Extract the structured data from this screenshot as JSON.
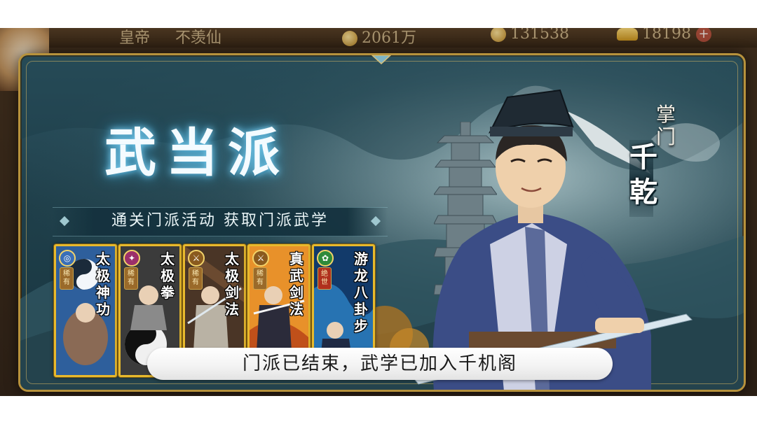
{
  "topbar": {
    "rank_text": "皇帝",
    "player_title": "不羡仙",
    "currency_1": "2061万",
    "currency_2": "131538",
    "currency_3": "18198"
  },
  "popup": {
    "title": "武当派",
    "subtitle": "通关门派活动  获取门派武学",
    "master": {
      "label": "掌门",
      "name": "千乾"
    },
    "cards": [
      {
        "name": "太极神功",
        "rarity": "稀有",
        "color": "#3a6fb8"
      },
      {
        "name": "太极拳",
        "rarity": "稀有",
        "color": "#333333"
      },
      {
        "name": "太极剑法",
        "rarity": "稀有",
        "color": "#5a4030"
      },
      {
        "name": "真武剑法",
        "rarity": "稀有",
        "color": "#e08a1e"
      },
      {
        "name": "游龙八卦步",
        "rarity": "绝世",
        "color": "#1c5f9c"
      }
    ],
    "status_text": "门派已结束，武学已加入千机阁"
  },
  "colors": {
    "frame_gold": "#b7923c",
    "card_border": "#e7b92d",
    "panel_teal": "#1f3f4a"
  }
}
